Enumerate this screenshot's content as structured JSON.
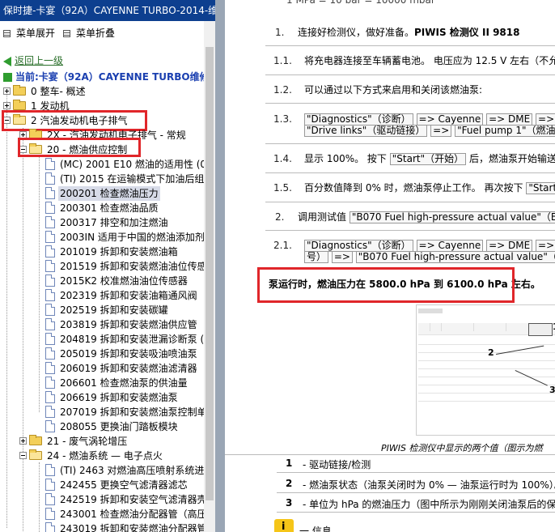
{
  "window": {
    "title": "保时捷-卡宴（92A）CAYENNE TURBO-2014-维修"
  },
  "menu": {
    "expand_label": "菜单展开",
    "collapse_label": "菜单折叠"
  },
  "nav": {
    "back_label": "返回上一级",
    "current_label": "当前:卡宴（92A）CAYENNE TURBO维修手册"
  },
  "tree": {
    "n0": "0 整车- 概述",
    "n1": "1 发动机",
    "n2": "2 汽油发动机电子排气",
    "n2x": "2X - 汽油发动机电子排气 - 常规",
    "n20": "20 - 燃油供应控制",
    "d1": "(MC) 2001 E10 燃油的适用性 (02",
    "d2": "(TI) 2015 在运输模式下加油后组合",
    "d3": "200201 检查燃油压力",
    "d4": "200301 检查燃油品质",
    "d5": "200317 排空和加注燃油",
    "d6": "2003IN 适用于中国的燃油添加剂",
    "d7": "201019 拆卸和安装燃油箱",
    "d8": "201519 拆卸和安装燃油油位传感器",
    "d9": "2015K2 校准燃油油位传感器",
    "d10": "202319 拆卸和安装油箱通风阀",
    "d11": "202519 拆卸和安装碳罐",
    "d12": "203819 拆卸和安装燃油供应管",
    "d13": "204819 拆卸和安装泄漏诊断泵 (",
    "d14": "205019 拆卸和安装吸油喷油泵",
    "d15": "206019 拆卸和安装燃油滤清器",
    "d16": "206601 检查燃油泵的供油量",
    "d17": "206619 拆卸和安装燃油泵",
    "d18": "207019 拆卸和安装燃油泵控制单元",
    "d19": "208055 更换油门踏板模块",
    "n21": "21 - 废气涡轮增压",
    "n24": "24 - 燃油系统 — 电子点火",
    "e1": "(TI) 2463 对燃油高压喷射系统进行",
    "e2": "242455 更换空气滤清器滤芯",
    "e3": "242519 拆卸和安装空气滤清器壳体",
    "e4": "243001 检查燃油分配器管（高压系",
    "e5": "243019 拆卸和安装燃油分配器管"
  },
  "doc": {
    "top_cut": "1 MPa = 10 bar = 10000 mbar",
    "s1_num": "1.",
    "s1_text": "连接好检测仪，做好准备。",
    "s1_bold": "PIWIS 检测仪 II 9818",
    "s11_num": "1.1.",
    "s11_text": "将充电器连接至车辆蓄电池。 电压应为 12.5 V 左右（不允",
    "s12_num": "1.2.",
    "s12_text": "可以通过以下方式来启用和关闭该燃油泵:",
    "s13_num": "1.3.",
    "s13_a": "\"Diagnostics\"（诊断）",
    "s13_b": "=> Cayenne",
    "s13_c": "=> DME",
    "s13_d": "=> \"Drive lin",
    "s13_e": "\"Drive links\"（驱动链接）",
    "s13_f": "=>",
    "s13_g": "\"Fuel pump 1\"（燃油泵 1",
    "s14_num": "1.4.",
    "s14_text1": "显示 100%。 按下",
    "s14_btn": "\"Start\"（开始）",
    "s14_text2": "后，燃油泵开始输送燃",
    "s15_num": "1.5.",
    "s15_text": "百分数值降到 0% 时，燃油泵停止工作。 再次按下",
    "s15_btn": "\"Start",
    "s2_num": "2.",
    "s2_text": "调用测试值",
    "s2_btn": "\"B070 Fuel high-pressure actual value\"（B070",
    "s21_num": "2.1.",
    "s21_a": "\"Diagnostics\"（诊断）",
    "s21_b": "=> Cayenne",
    "s21_c": "=> DME",
    "s21_d": "=> \"Actual v",
    "s21_e": "号）",
    "s21_f": "=>",
    "s21_g": "\"B070 Fuel high-pressure actual value\"（B070 燃",
    "highlight": "泵运行时，燃油压力在 5800.0 hPa 到 6100.0 hPa 左右。",
    "caption": "PIWIS 检测仪中显示的两个值（图示为燃",
    "callout_1": "1",
    "callout_2": "2",
    "callout_3": "3",
    "legend": [
      {
        "num": "1",
        "text": "- 驱动链接/检测"
      },
      {
        "num": "2",
        "text": "- 燃油泵状态（油泵关闭时为 0% — 油泵运行时为 100%）。"
      },
      {
        "num": "3",
        "text": "- 单位为 hPa 的燃油压力（图中所示为刚刚关闭油泵后的保持"
      }
    ],
    "note_label": "一 信息"
  }
}
